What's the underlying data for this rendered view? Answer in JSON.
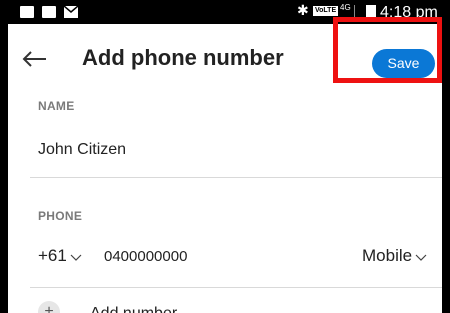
{
  "status_bar": {
    "time": "4:18 pm",
    "network": "4G",
    "volte": "VoLTE"
  },
  "header": {
    "title": "Add phone number",
    "save_label": "Save"
  },
  "name_section": {
    "label": "NAME",
    "value": "John Citizen"
  },
  "phone_section": {
    "label": "PHONE",
    "country_code": "+61",
    "number": "0400000000",
    "type": "Mobile"
  },
  "add_more": {
    "label": "Add number"
  },
  "colors": {
    "accent": "#0b78d6",
    "highlight": "#ee1111"
  }
}
